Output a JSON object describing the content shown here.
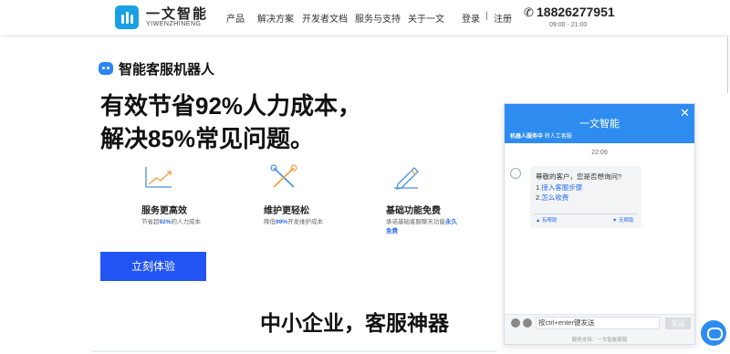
{
  "header": {
    "logo_cn": "一文智能",
    "logo_en": "YIWENZHINENG",
    "nav": [
      "产品",
      "解决方案",
      "开发者文档",
      "服务与支持",
      "关于一文"
    ],
    "login": "登录",
    "separator": "|",
    "register": "注册",
    "phone": "18826277951",
    "hours": "09:00 - 21:00"
  },
  "hero": {
    "product_name": "智能客服机器人",
    "headline_line1": "有效节省92%人力成本，",
    "headline_line2": "解决85%常见问题。",
    "features": [
      {
        "title": "服务更高效",
        "desc_pre": "节省超",
        "desc_highlight": "92%",
        "desc_post": "的人力成本"
      },
      {
        "title": "维护更轻松",
        "desc_pre": "降低",
        "desc_highlight": "99%",
        "desc_post": "开发维护成本"
      },
      {
        "title": "基础功能免费",
        "desc_pre": "承诺基础客服聊天功能",
        "desc_highlight": "永久免费",
        "desc_post": ""
      }
    ],
    "cta_label": "立刻体验",
    "sub_headline": "中小企业，客服神器"
  },
  "chat": {
    "title": "一文智能",
    "close": "✕",
    "status_prefix": "机器人服务中",
    "status_action": "转人工客服",
    "time": "22:09",
    "greeting": "尊敬的客户，您是否想询问?",
    "options": [
      {
        "index": "1.",
        "label": "接入客服步骤"
      },
      {
        "index": "2.",
        "label": "怎么收费"
      }
    ],
    "helpful": "有帮助",
    "unhelpful": "无帮助",
    "input_placeholder": "按ctrl+enter键发送",
    "send": "发送",
    "support": "服务支持：一文智能客服"
  },
  "colors": {
    "brand_blue": "#2e8cf0",
    "cta_blue": "#2254f4",
    "logo_blue": "#1aa0e6",
    "highlight": "#2a6cf6"
  },
  "icons": [
    "phone-icon",
    "robot-icon",
    "chart-icon",
    "tools-icon",
    "pen-icon",
    "close-icon",
    "emoji-icon",
    "upload-icon",
    "thumbs-up-icon",
    "thumbs-down-icon",
    "chat-bubble-icon"
  ]
}
